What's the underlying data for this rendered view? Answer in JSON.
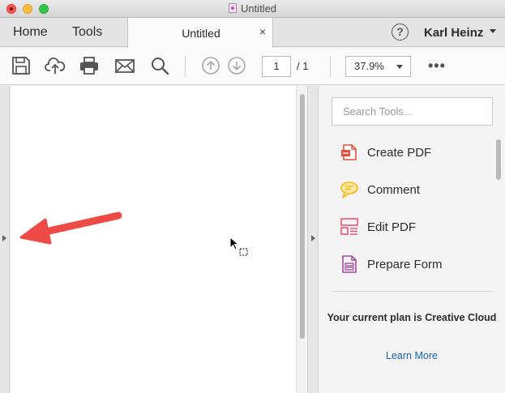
{
  "window": {
    "title": "Untitled"
  },
  "tabs": {
    "home": "Home",
    "tools": "Tools",
    "document": "Untitled",
    "close_glyph": "×"
  },
  "account": {
    "help_glyph": "?",
    "user_name": "Karl Heinz"
  },
  "toolbar": {
    "icons": [
      "save-icon",
      "upload-cloud-icon",
      "print-icon",
      "email-icon",
      "search-icon",
      "previous-page-icon",
      "next-page-icon"
    ],
    "page_current": "1",
    "page_total": "/ 1",
    "zoom": "37.9%",
    "more_glyph": "•••"
  },
  "tools_pane": {
    "search_placeholder": "Search Tools...",
    "items": [
      {
        "label": "Create PDF",
        "icon": "create-pdf-icon",
        "color": "#e0513c"
      },
      {
        "label": "Comment",
        "icon": "comment-icon",
        "color": "#f5b916"
      },
      {
        "label": "Edit PDF",
        "icon": "edit-pdf-icon",
        "color": "#e8567a"
      },
      {
        "label": "Prepare Form",
        "icon": "prepare-form-icon",
        "color": "#a5489f"
      }
    ],
    "plan_text": "Your current plan is Creative Cloud",
    "learn_more": "Learn More"
  },
  "colors": {
    "annotation_arrow": "#ef4b46",
    "link": "#1a62b9"
  }
}
